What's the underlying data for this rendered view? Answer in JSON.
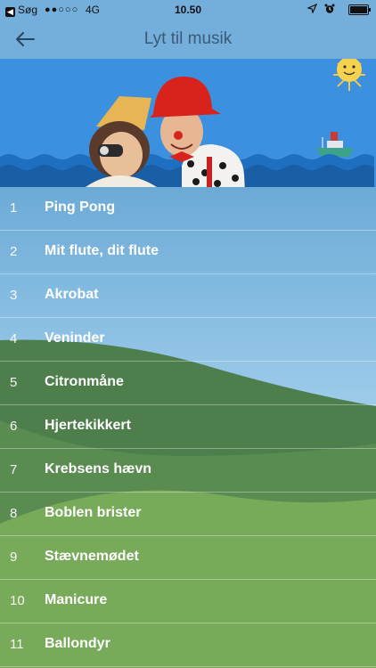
{
  "status_bar": {
    "back_label": "Søg",
    "signal": "●●○○○",
    "network": "4G",
    "time": "10.50"
  },
  "nav": {
    "title": "Lyt til musik",
    "back_icon": "arrow-left-icon"
  },
  "tracks": [
    {
      "number": "1",
      "title": "Ping Pong"
    },
    {
      "number": "2",
      "title": "Mit flute, dit flute"
    },
    {
      "number": "3",
      "title": "Akrobat"
    },
    {
      "number": "4",
      "title": "Veninder"
    },
    {
      "number": "5",
      "title": "Citronmåne"
    },
    {
      "number": "6",
      "title": "Hjertekikkert"
    },
    {
      "number": "7",
      "title": "Krebsens hævn"
    },
    {
      "number": "8",
      "title": "Boblen brister"
    },
    {
      "number": "9",
      "title": "Stævnemødet"
    },
    {
      "number": "10",
      "title": "Manicure"
    },
    {
      "number": "11",
      "title": "Ballondyr"
    }
  ],
  "colors": {
    "sky": "#74aedb",
    "hill_dark": "#4d7f4a",
    "hill_light": "#78ad5a",
    "sea": "#1f6fc0"
  }
}
